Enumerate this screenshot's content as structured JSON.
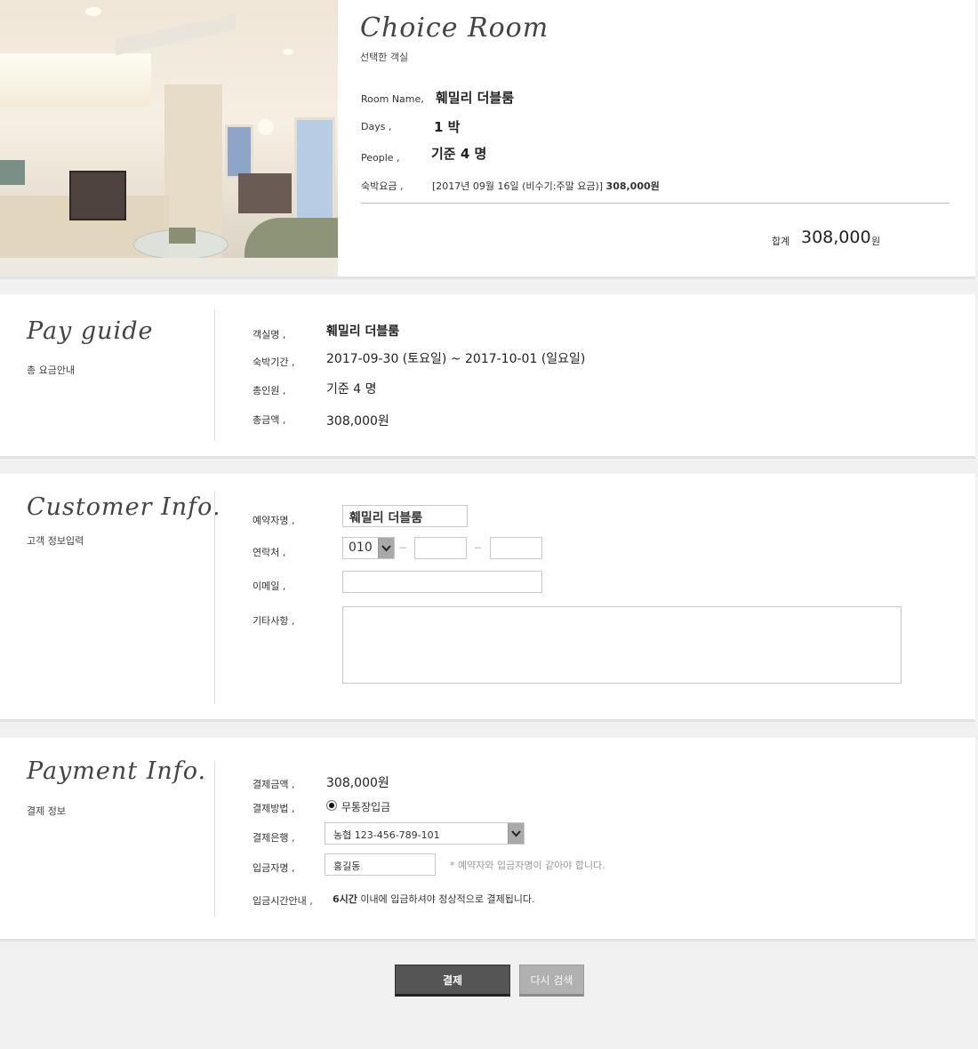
{
  "room": {
    "title": "Choice  Room",
    "subtitle": "선택한 객실",
    "name_label": "Room Name,",
    "name_value": "훼밀리 더블룸",
    "days_label": "Days ,",
    "days_value": "1 박",
    "people_label": "People ,",
    "people_value": "기준 4 명",
    "fee_label": "숙박요금 ,",
    "fee_detail": "[2017년 09월 16일 (비수기:주말 요금)]",
    "fee_amount": "308,000원",
    "total_label": "합계",
    "total_value": "308,000",
    "total_unit": "원"
  },
  "pay_guide": {
    "title": "Pay guide",
    "subtitle": "총 요금안내",
    "rows": [
      {
        "label": "객실명 ,",
        "value": "훼밀리 더블룸"
      },
      {
        "label": "숙박기간 ,",
        "value": "2017-09-30 (토요일) ~ 2017-10-01 (일요일)"
      },
      {
        "label": "총인원 ,",
        "value": "기준 4 명"
      },
      {
        "label": "총금액 ,",
        "value": "308,000원"
      }
    ]
  },
  "customer": {
    "title": "Customer Info.",
    "subtitle": "고객 정보입력",
    "name_label": "예약자명 ,",
    "name_value": "훼밀리 더블룸",
    "phone_label": "연락처 ,",
    "phone_prefix": "010",
    "phone_sep": "─",
    "phone_mid": "",
    "phone_last": "",
    "email_label": "이메일 ,",
    "email_value": "",
    "note_label": "기타사항 ,",
    "note_value": ""
  },
  "payment": {
    "title": "Payment Info.",
    "subtitle": "결제 정보",
    "amount_label": "결제금액 ,",
    "amount_value": "308,000원",
    "method_label": "결제방법 ,",
    "method_value": "무통장입금",
    "bank_label": "결제은행 ,",
    "bank_value": "농협 123-456-789-101",
    "depositor_label": "입금자명 ,",
    "depositor_value": "홍길동",
    "depositor_note": "* 예약자와 입금자명이 같아야 합니다.",
    "time_label": "입금시간안내 ,",
    "time_strong": "6시간",
    "time_rest": " 이내에 입금하셔야 정상적으로 결제됩니다."
  },
  "buttons": {
    "pay": "결제",
    "research": "다시 검색"
  },
  "icons": {
    "select_arrow": "chevron-down-icon",
    "radio": "radio-selected-icon"
  }
}
